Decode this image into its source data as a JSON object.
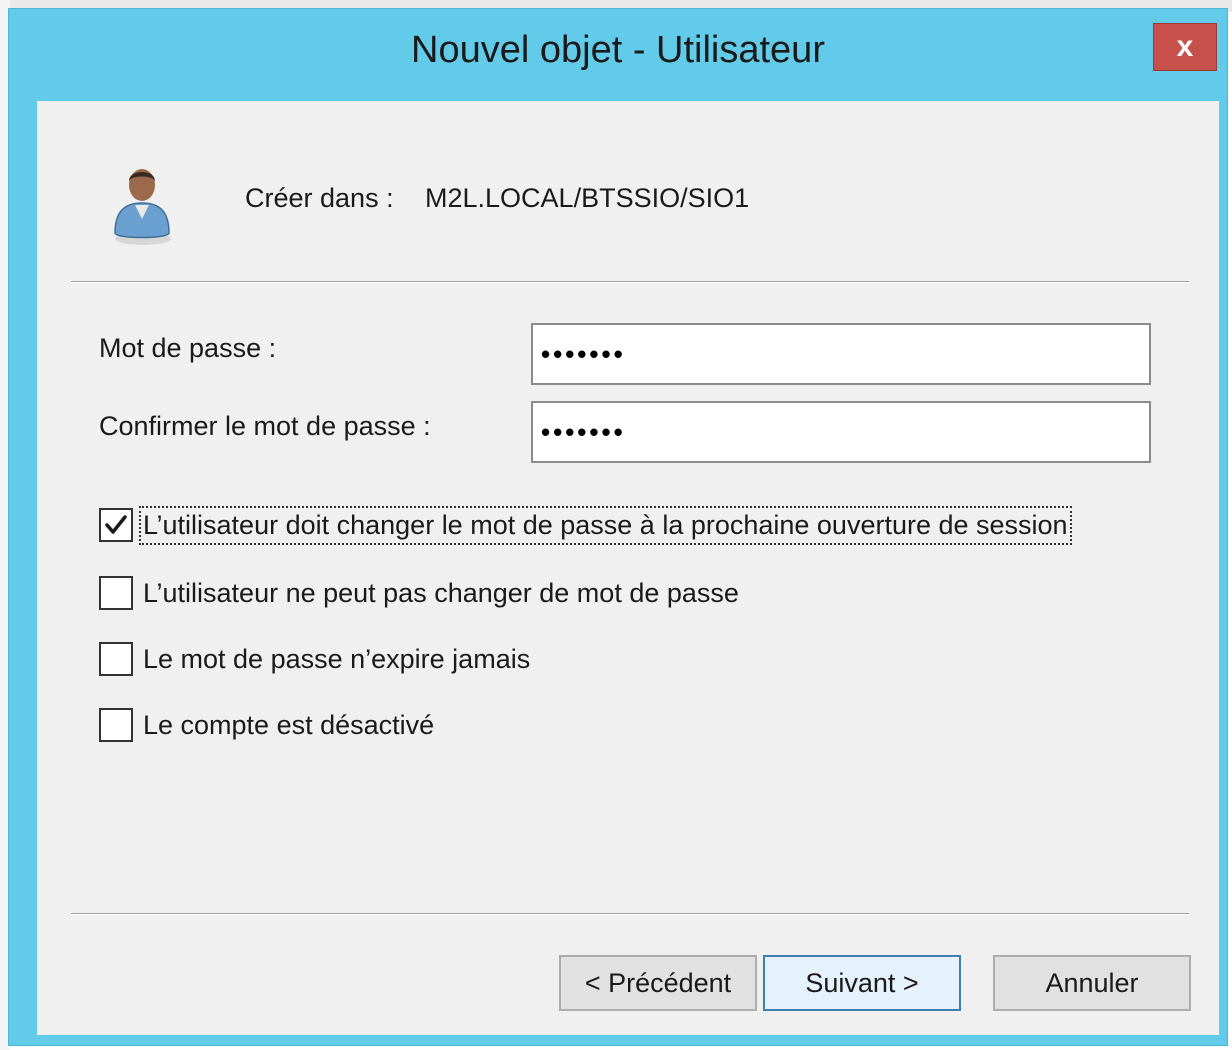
{
  "window": {
    "title": "Nouvel objet - Utilisateur",
    "close_label": "x",
    "title_color": "#62cbea"
  },
  "header": {
    "icon": "user-icon",
    "create_in_label": "Créer dans :",
    "create_in_path": "M2L.LOCAL/BTSSIO/SIO1"
  },
  "form": {
    "password_label": "Mot de passe :",
    "password_value": "•••••••",
    "confirm_label": "Confirmer le mot de passe :",
    "confirm_value": "•••••••"
  },
  "options": [
    {
      "label": "L’utilisateur doit changer le mot de passe à la prochaine ouverture de session",
      "checked": true
    },
    {
      "label": "L’utilisateur ne peut pas changer de mot de passe",
      "checked": false
    },
    {
      "label": "Le mot de passe n’expire jamais",
      "checked": false
    },
    {
      "label": "Le compte est désactivé",
      "checked": false
    }
  ],
  "buttons": {
    "previous": "< Précédent",
    "next": "Suivant >",
    "cancel": "Annuler"
  }
}
